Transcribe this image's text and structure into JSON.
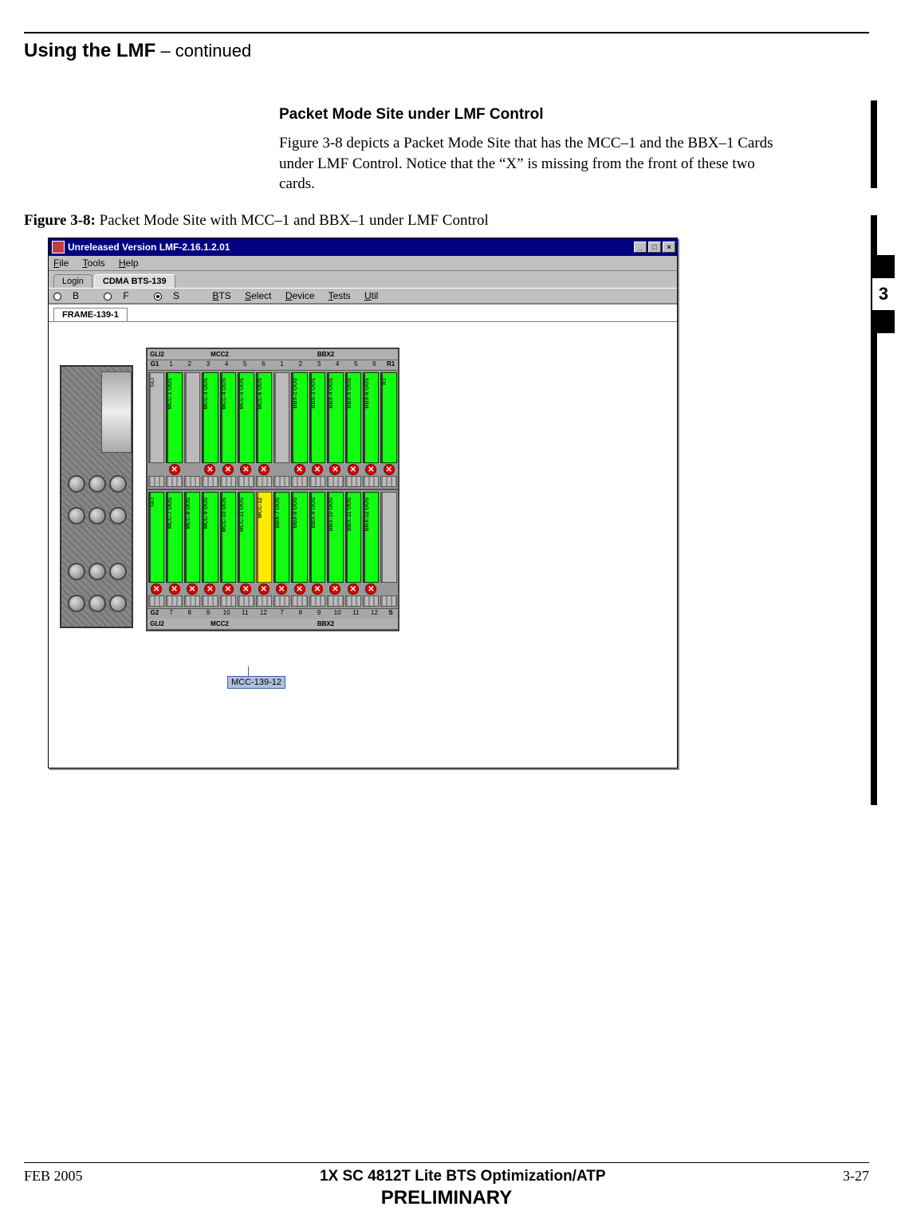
{
  "header": {
    "section_title": "Using the LMF",
    "continued": " – continued"
  },
  "subsection": {
    "heading": "Packet Mode Site under LMF Control",
    "paragraph": "Figure 3-8 depicts a Packet Mode Site that has the MCC–1 and the BBX–1 Cards under LMF Control. Notice that the “X” is missing from the front of these two cards."
  },
  "figure": {
    "label": "Figure 3-8:",
    "caption": " Packet Mode Site with MCC–1 and BBX–1 under LMF Control"
  },
  "tab_marker": "3",
  "app": {
    "title": "Unreleased Version LMF-2.16.1.2.01",
    "menus": [
      "File",
      "Tools",
      "Help"
    ],
    "tabs": {
      "login": "Login",
      "bts": "CDMA BTS-139"
    },
    "submenu_radios": {
      "b": "B",
      "f": "F",
      "s": "S"
    },
    "submenu_items": [
      "BTS",
      "Select",
      "Device",
      "Tests",
      "Util"
    ],
    "frame_tab": "FRAME-139-1",
    "rack_header_top": {
      "left": "GLI2",
      "mid1": "MCC2",
      "mid2": "BBX2"
    },
    "rack_nums_top": {
      "left_edge": "G1",
      "right_edge": "R1",
      "nums": [
        "1",
        "2",
        "3",
        "4",
        "5",
        "6",
        "1",
        "2",
        "3",
        "4",
        "5",
        "6"
      ]
    },
    "rack_nums_bottom": {
      "left_edge": "G2",
      "right_edge": "S",
      "nums": [
        "7",
        "8",
        "9",
        "10",
        "11",
        "12",
        "7",
        "8",
        "9",
        "10",
        "11",
        "12"
      ]
    },
    "rack_header_bottom": {
      "left": "GLI2",
      "mid1": "MCC2",
      "mid2": "BBX2"
    },
    "shelf_top": [
      {
        "color": "gray",
        "x": false,
        "label": "GLI"
      },
      {
        "color": "green",
        "x": true,
        "label": "MCC-1 OOS"
      },
      {
        "color": "gray",
        "x": false,
        "label": ""
      },
      {
        "color": "green",
        "x": true,
        "label": "MCC-3 OOS"
      },
      {
        "color": "green",
        "x": true,
        "label": "MCC-4 OOS"
      },
      {
        "color": "green",
        "x": true,
        "label": "MCC-5 OOS"
      },
      {
        "color": "green",
        "x": true,
        "label": "MCC-6 OOS"
      },
      {
        "color": "gray",
        "x": false,
        "label": ""
      },
      {
        "color": "green",
        "x": true,
        "label": "BBX-2 OOS"
      },
      {
        "color": "green",
        "x": true,
        "label": "BBX-3 OOS"
      },
      {
        "color": "green",
        "x": true,
        "label": "BBX-4 OOS"
      },
      {
        "color": "green",
        "x": true,
        "label": "BBX-5 OOS"
      },
      {
        "color": "green",
        "x": true,
        "label": "BBX-6 OOS"
      },
      {
        "color": "green",
        "x": true,
        "label": "R1"
      }
    ],
    "shelf_bottom": [
      {
        "color": "green",
        "x": true,
        "label": "GLI"
      },
      {
        "color": "green",
        "x": true,
        "label": "MCC-7 OOS"
      },
      {
        "color": "green",
        "x": true,
        "label": "MCC-8 OOS"
      },
      {
        "color": "green",
        "x": true,
        "label": "MCC-9 OOS"
      },
      {
        "color": "green",
        "x": true,
        "label": "MCC-10 OOS"
      },
      {
        "color": "green",
        "x": true,
        "label": "MCC-11 OOS"
      },
      {
        "color": "yellow",
        "x": true,
        "label": "MCC-12"
      },
      {
        "color": "green",
        "x": true,
        "label": "BBX-7 OOS"
      },
      {
        "color": "green",
        "x": true,
        "label": "BBX-8 OOS"
      },
      {
        "color": "green",
        "x": true,
        "label": "BBX-9 OOS"
      },
      {
        "color": "green",
        "x": true,
        "label": "BBX-10 OOS"
      },
      {
        "color": "green",
        "x": true,
        "label": "BBX-11 OOS"
      },
      {
        "color": "green",
        "x": true,
        "label": "BBX-12 OOS"
      },
      {
        "color": "gray",
        "x": false,
        "label": ""
      }
    ],
    "tooltip": "MCC-139-12",
    "win_buttons": {
      "min": "_",
      "max": "□",
      "close": "×"
    }
  },
  "footer": {
    "left": "FEB 2005",
    "center": "1X SC 4812T Lite BTS Optimization/ATP",
    "right": "3-27",
    "bottom": "PRELIMINARY"
  }
}
